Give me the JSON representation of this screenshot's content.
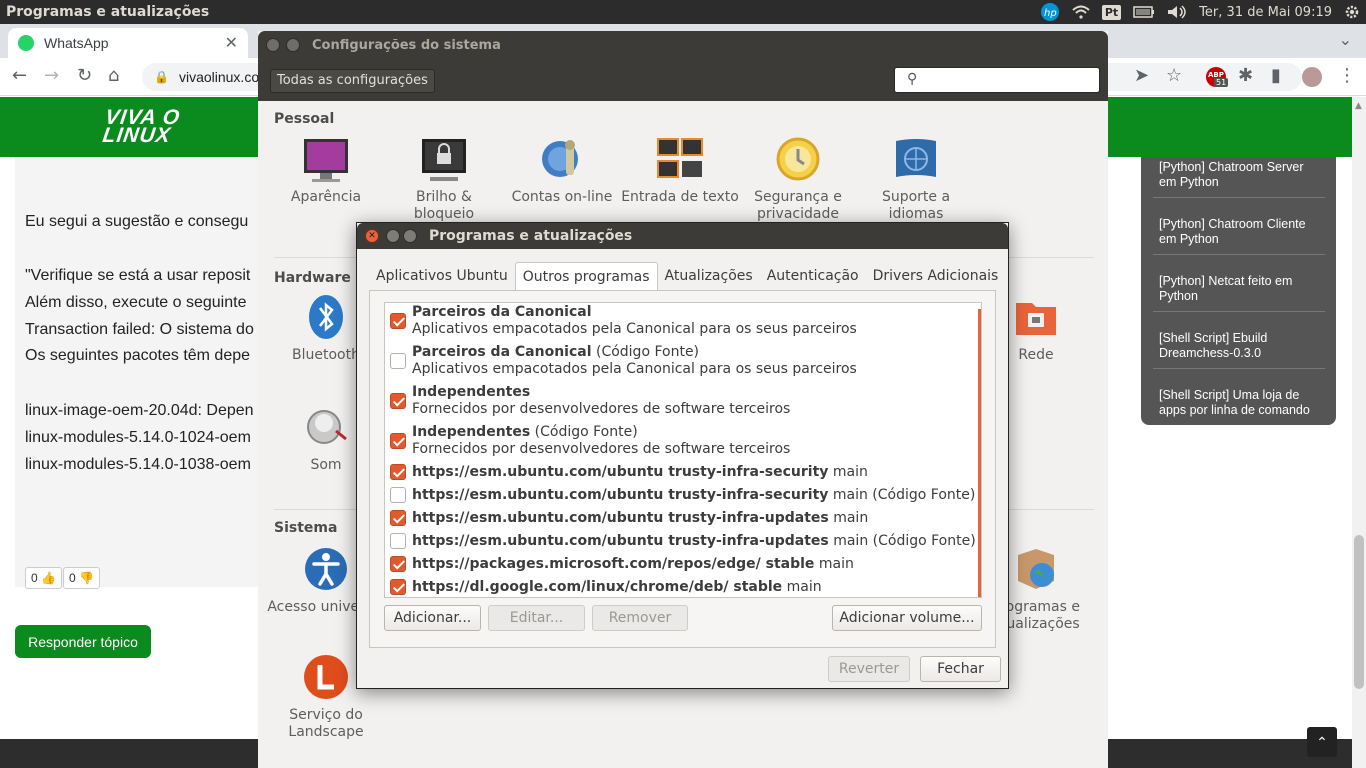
{
  "panel": {
    "title": "Programas e atualizações",
    "kb": "Pt",
    "clock": "Ter, 31 de Mai 09:19"
  },
  "browser": {
    "tab_title": "WhatsApp",
    "url": "vivaolinux.com",
    "badge": "51",
    "ext_label": "ABP"
  },
  "site": {
    "logo": [
      "VIVA O",
      "LINUX"
    ],
    "post_lines": [
      "Eu segui a sugestão e consegu",
      "\"Verifique se está a usar reposit",
      "Além disso, execute o seguinte",
      "Transaction failed: O sistema do",
      "Os seguintes pacotes têm depe",
      "linux-image-oem-20.04d: Depen",
      "linux-modules-5.14.0-1024-oem",
      "linux-modules-5.14.0-1038-oem"
    ],
    "votes": [
      "0",
      "0"
    ],
    "reply_label": "Responder tópico",
    "sidebar_links": [
      "[Python] Chatroom Server em Python",
      "[Python] Chatroom Cliente em Python",
      "[Python] Netcat feito em Python",
      "[Shell Script] Ebuild Dreamchess-0.3.0",
      "[Shell Script] Uma loja de apps por linha de comando"
    ]
  },
  "settings": {
    "title": "Configurações do sistema",
    "all_settings": "Todas as configurações",
    "sections": {
      "personal": "Pessoal",
      "hardware": "Hardware",
      "system": "Sistema"
    },
    "personal": [
      {
        "label": "Aparência",
        "icon": "appearance-icon"
      },
      {
        "label": "Brilho & bloqueio",
        "icon": "brightness-lock-icon"
      },
      {
        "label": "Contas on-line",
        "icon": "online-accounts-icon"
      },
      {
        "label": "Entrada de texto",
        "icon": "text-entry-icon"
      },
      {
        "label": "Segurança e privacidade",
        "icon": "security-privacy-icon"
      },
      {
        "label": "Suporte a idiomas",
        "icon": "language-support-icon"
      }
    ],
    "hardware": [
      {
        "label": "Bluetooth",
        "icon": "bluetooth-icon"
      },
      {
        "label": "Rede",
        "icon": "network-icon"
      },
      {
        "label": "Som",
        "icon": "sound-icon"
      }
    ],
    "system": [
      {
        "label": "Acesso universal",
        "icon": "universal-access-icon"
      },
      {
        "label": "Programas e atualizações",
        "icon": "software-updates-icon"
      },
      {
        "label": "Serviço do Landscape",
        "icon": "landscape-icon"
      }
    ]
  },
  "dialog": {
    "title": "Programas e atualizações",
    "tabs": [
      "Aplicativos Ubuntu",
      "Outros programas",
      "Atualizações",
      "Autenticação",
      "Drivers Adicionais"
    ],
    "active_tab": "Outros programas",
    "sources": [
      {
        "checked": true,
        "name": "Parceiros da Canonical",
        "suffix": "",
        "desc": "Aplicativos empacotados pela Canonical para os seus parceiros"
      },
      {
        "checked": false,
        "name": "Parceiros da Canonical",
        "suffix": " (Código Fonte)",
        "desc": "Aplicativos empacotados pela Canonical para os seus parceiros"
      },
      {
        "checked": true,
        "name": "Independentes",
        "suffix": "",
        "desc": "Fornecidos por desenvolvedores de software terceiros"
      },
      {
        "checked": true,
        "name": "Independentes",
        "suffix": " (Código Fonte)",
        "desc": "Fornecidos por desenvolvedores de software terceiros"
      },
      {
        "checked": true,
        "name": "https://esm.ubuntu.com/ubuntu trusty-infra-security",
        "suffix": " main",
        "desc": ""
      },
      {
        "checked": false,
        "name": "https://esm.ubuntu.com/ubuntu trusty-infra-security",
        "suffix": " main (Código Fonte)",
        "desc": ""
      },
      {
        "checked": true,
        "name": "https://esm.ubuntu.com/ubuntu trusty-infra-updates",
        "suffix": " main",
        "desc": ""
      },
      {
        "checked": false,
        "name": "https://esm.ubuntu.com/ubuntu trusty-infra-updates",
        "suffix": " main (Código Fonte)",
        "desc": ""
      },
      {
        "checked": true,
        "name": "https://packages.microsoft.com/repos/edge/ stable",
        "suffix": " main",
        "desc": ""
      },
      {
        "checked": true,
        "name": "https://dl.google.com/linux/chrome/deb/ stable",
        "suffix": " main",
        "desc": ""
      }
    ],
    "buttons": {
      "add": "Adicionar...",
      "edit": "Editar...",
      "remove": "Remover",
      "add_volume": "Adicionar volume...",
      "revert": "Reverter",
      "close": "Fechar"
    }
  }
}
